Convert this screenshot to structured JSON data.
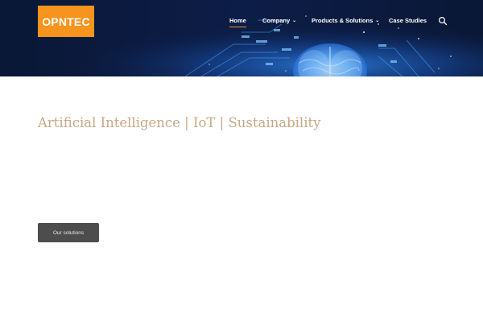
{
  "brand": {
    "logo_text": "OPNTEC",
    "accent_color": "#f7941d"
  },
  "nav": {
    "home": "Home",
    "company": "Company",
    "products": "Products & Solutions",
    "case_studies": "Case Studies",
    "active": "Home",
    "search_icon": "search-icon",
    "chevron_icon": "chevron-down-icon"
  },
  "hero": {
    "headline": "Artificial Intelligence | IoT | Sustainability",
    "cta_label": "Our solutions",
    "headline_color": "#c7a785",
    "header_bg": "#0b1a3d"
  }
}
